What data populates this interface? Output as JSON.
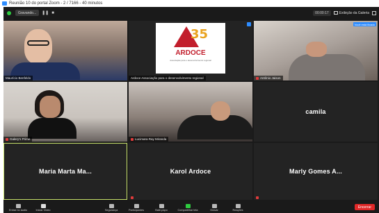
{
  "window": {
    "title": "Reunião 10 do portal Zoom - 2 / 7166 - 40 minutos"
  },
  "topbar": {
    "info_label": "Gravando...",
    "timer": "00:00:17",
    "view_label": "Exibição da Galeria"
  },
  "tiles": [
    {
      "name": "Maurício Benfeldo",
      "video": true,
      "muted": false
    },
    {
      "name": "Ardoce Associação para o desenvolvimento regional",
      "video": true,
      "muted": false,
      "pin_label": ""
    },
    {
      "name": "Antônio Jaison",
      "video": true,
      "muted": true,
      "pin_label": "Você está fixado"
    },
    {
      "name": "Galery's Prime",
      "video": true,
      "muted": true
    },
    {
      "name": "Lucimara Ray Miranda",
      "video": true,
      "muted": true
    },
    {
      "name": "camila",
      "video": false,
      "muted": false
    },
    {
      "name": "Maria Marta Ma...",
      "video": false,
      "muted": false,
      "active": true
    },
    {
      "name": "Karol Ardoce",
      "video": false,
      "muted": true
    },
    {
      "name": "Marly Gomes A...",
      "video": false,
      "muted": true
    }
  ],
  "logo": {
    "number": "35",
    "text": "ARDOCE",
    "subtitle": "Associação para o desenvolvimento regional"
  },
  "toolbar": {
    "items": [
      {
        "label": "Entrar no áudio",
        "icon": "headphones-icon"
      },
      {
        "label": "Iniciar Vídeo",
        "icon": "video-off-icon"
      },
      {
        "label": "Segurança",
        "icon": "shield-icon"
      },
      {
        "label": "Participantes",
        "icon": "participants-icon"
      },
      {
        "label": "Bate-papo",
        "icon": "chat-icon"
      },
      {
        "label": "Compartilhar tela",
        "icon": "share-screen-icon"
      },
      {
        "label": "Gravar",
        "icon": "record-icon"
      },
      {
        "label": "Reações",
        "icon": "reactions-icon"
      }
    ],
    "end_label": "Encerrar"
  },
  "colors": {
    "end_red": "#e02828",
    "share_green": "#2ecc40",
    "active_border": "#c8e26b",
    "zoom_blue": "#2d8cff"
  }
}
